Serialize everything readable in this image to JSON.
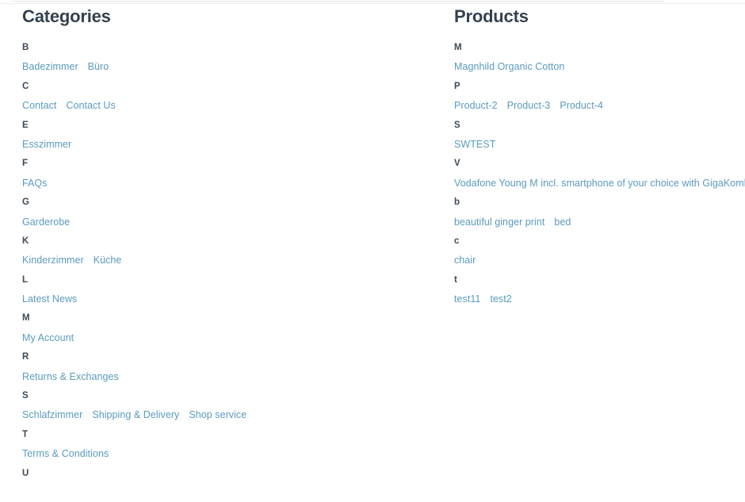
{
  "page": {
    "background_color": "#ffffff",
    "heading_color": "#34424f",
    "letter_color": "#3d4a57",
    "link_color": "#5a9bbd",
    "rule_color": "#e6e7e9"
  },
  "columns": [
    {
      "id": "categories",
      "title": "Categories",
      "groups": [
        {
          "letter": "B",
          "items": [
            "Badezimmer",
            "Büro"
          ]
        },
        {
          "letter": "C",
          "items": [
            "Contact",
            "Contact Us"
          ]
        },
        {
          "letter": "E",
          "items": [
            "Esszimmer"
          ]
        },
        {
          "letter": "F",
          "items": [
            "FAQs"
          ]
        },
        {
          "letter": "G",
          "items": [
            "Garderobe"
          ]
        },
        {
          "letter": "K",
          "items": [
            "Kinderzimmer",
            "Küche"
          ]
        },
        {
          "letter": "L",
          "items": [
            "Latest News"
          ]
        },
        {
          "letter": "M",
          "items": [
            "My Account"
          ]
        },
        {
          "letter": "R",
          "items": [
            "Returns & Exchanges"
          ]
        },
        {
          "letter": "S",
          "items": [
            "Schlafzimmer",
            "Shipping & Delivery",
            "Shop service"
          ]
        },
        {
          "letter": "T",
          "items": [
            "Terms & Conditions"
          ]
        },
        {
          "letter": "U",
          "items": []
        }
      ]
    },
    {
      "id": "products",
      "title": "Products",
      "groups": [
        {
          "letter": "M",
          "items": [
            "Magnhild Organic Cotton"
          ]
        },
        {
          "letter": "P",
          "items": [
            "Product-2",
            "Product-3",
            "Product-4"
          ]
        },
        {
          "letter": "S",
          "items": [
            "SWTEST"
          ]
        },
        {
          "letter": "V",
          "items": [
            "Vodafone Young M incl. smartphone of your choice with GigaKombi"
          ]
        },
        {
          "letter": "b",
          "items": [
            "beautiful ginger print",
            "bed"
          ]
        },
        {
          "letter": "c",
          "items": [
            "chair"
          ]
        },
        {
          "letter": "t",
          "items": [
            "test11",
            "test2"
          ]
        }
      ]
    }
  ]
}
